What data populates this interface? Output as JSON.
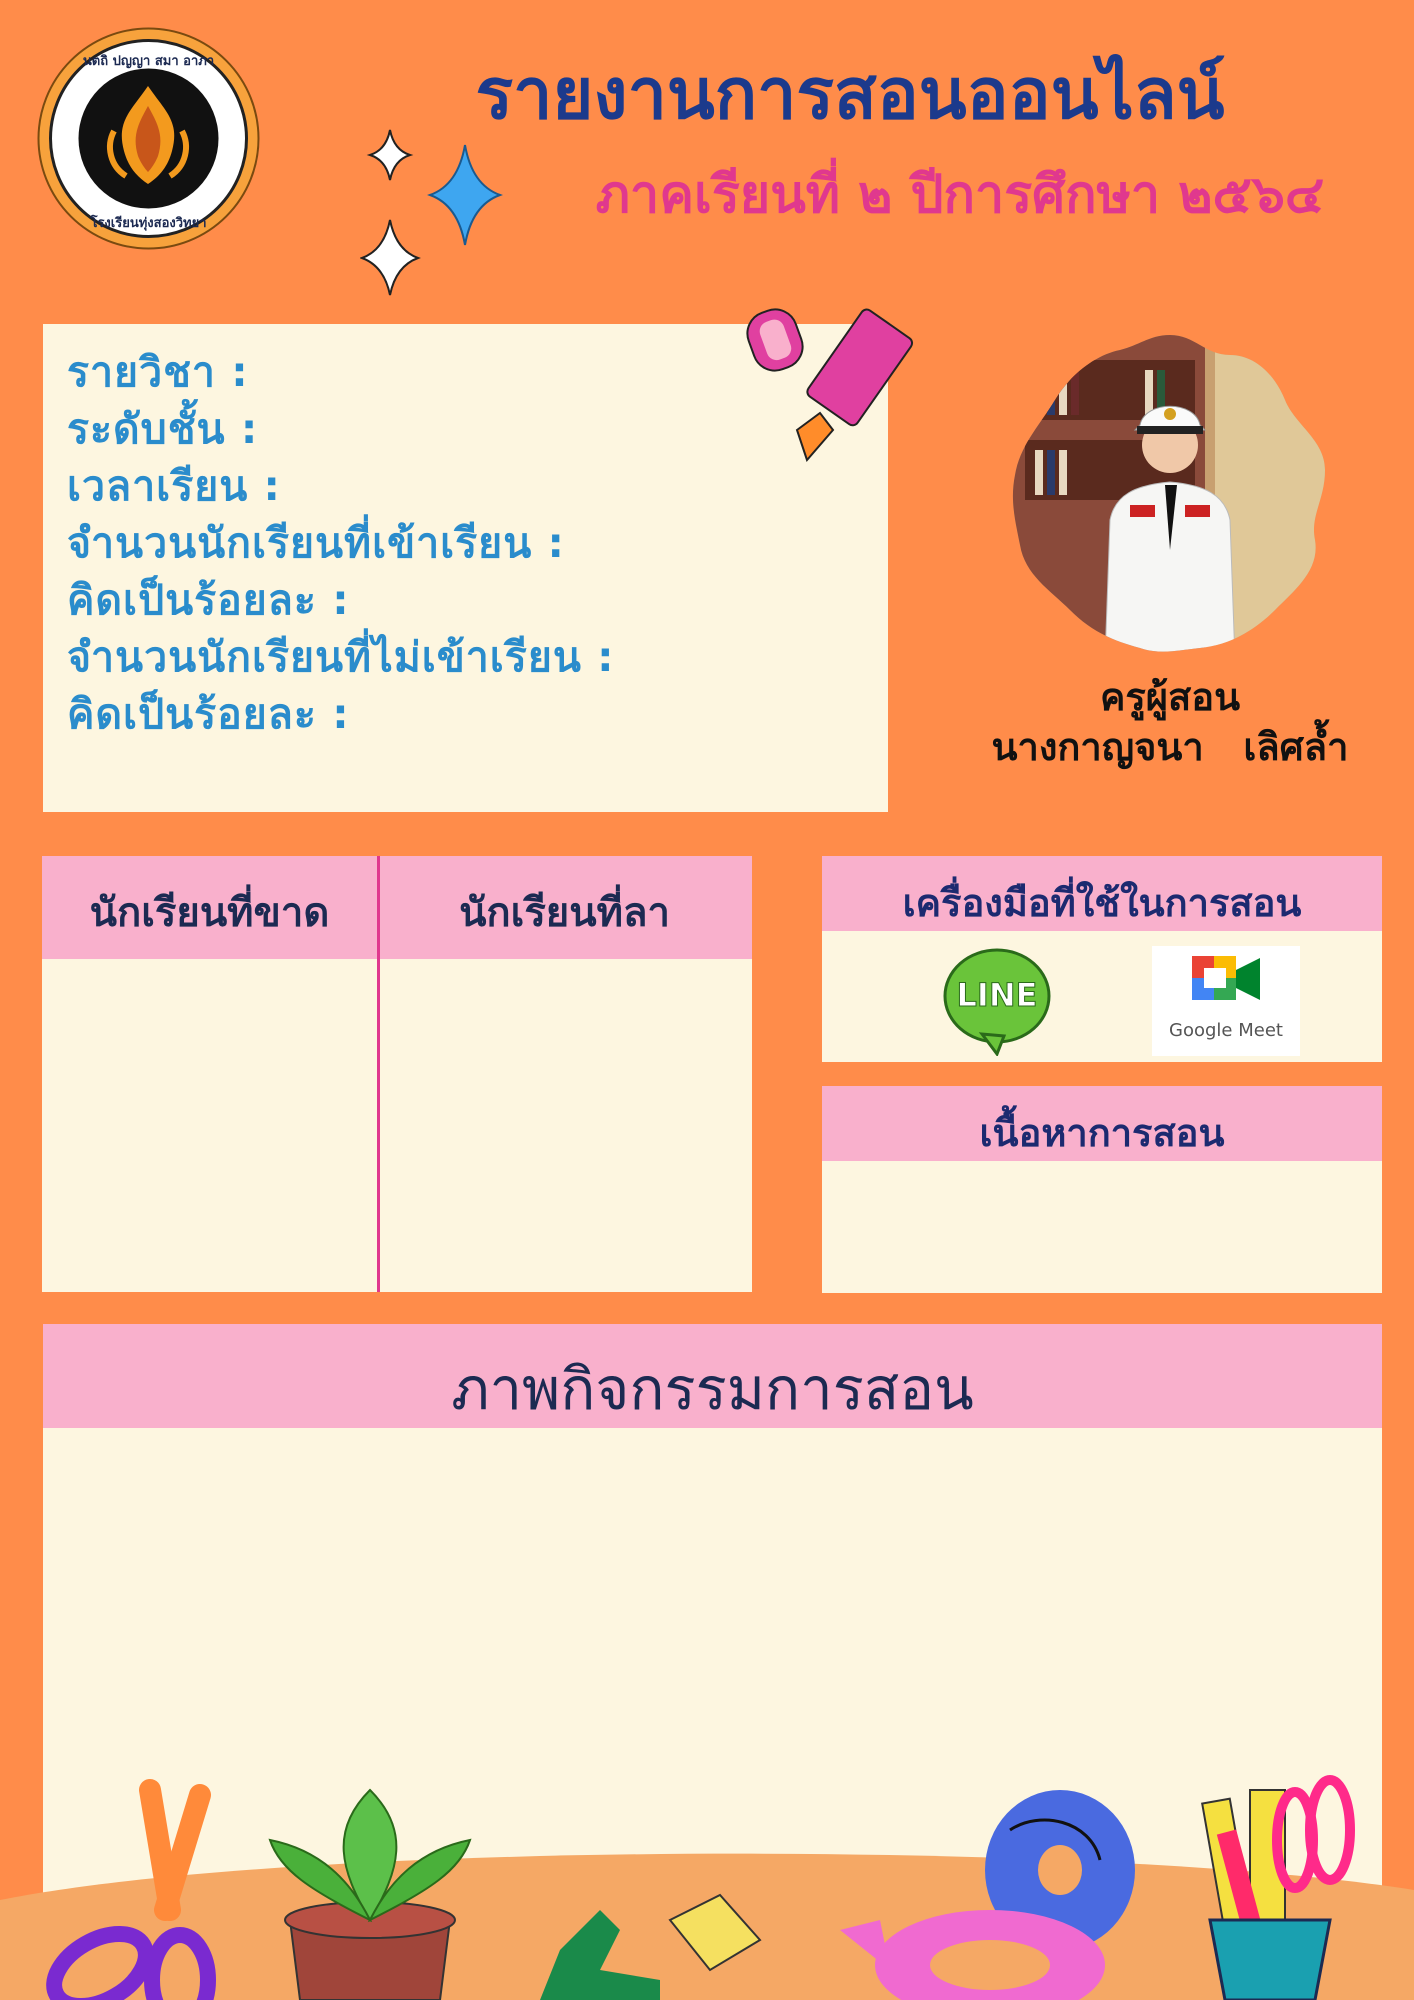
{
  "seal": {
    "top_text": "นตถิ ปญญา สมา อาภา",
    "bottom_text": "โรงเรียนทุ่งสองวิทยา"
  },
  "header": {
    "title": "รายงานการสอนออนไลน์",
    "subtitle": "ภาคเรียนที่ ๒ ปีการศึกษา ๒๕๖๔"
  },
  "info": {
    "subject": "รายวิชา :",
    "level": "ระดับชั้น :",
    "time": "เวลาเรียน :",
    "attend_count": "จำนวนนักเรียนที่เข้าเรียน :",
    "attend_percent": "คิดเป็นร้อยละ :",
    "absent_count": "จำนวนนักเรียนที่ไม่เข้าเรียน :",
    "absent_percent": "คิดเป็นร้อยละ :"
  },
  "teacher": {
    "role": "ครูผู้สอน",
    "name": "นางกาญจนา   เลิศล้ำ"
  },
  "students_table": {
    "absent_header": "นักเรียนที่ขาด",
    "leave_header": "นักเรียนที่ลา"
  },
  "tools": {
    "header": "เครื่องมือที่ใช้ในการสอน",
    "line_label": "LINE",
    "meet_label": "Google Meet"
  },
  "content": {
    "header": "เนื้อหาการสอน"
  },
  "activities": {
    "header": "ภาพกิจกรรมการสอน"
  },
  "colors": {
    "background": "#ff8c4a",
    "panel": "#fdf6e0",
    "header_bar": "#f9b0cc",
    "title": "#1c3a8c",
    "subtitle": "#e0388e",
    "info_text": "#2a8ccc"
  }
}
